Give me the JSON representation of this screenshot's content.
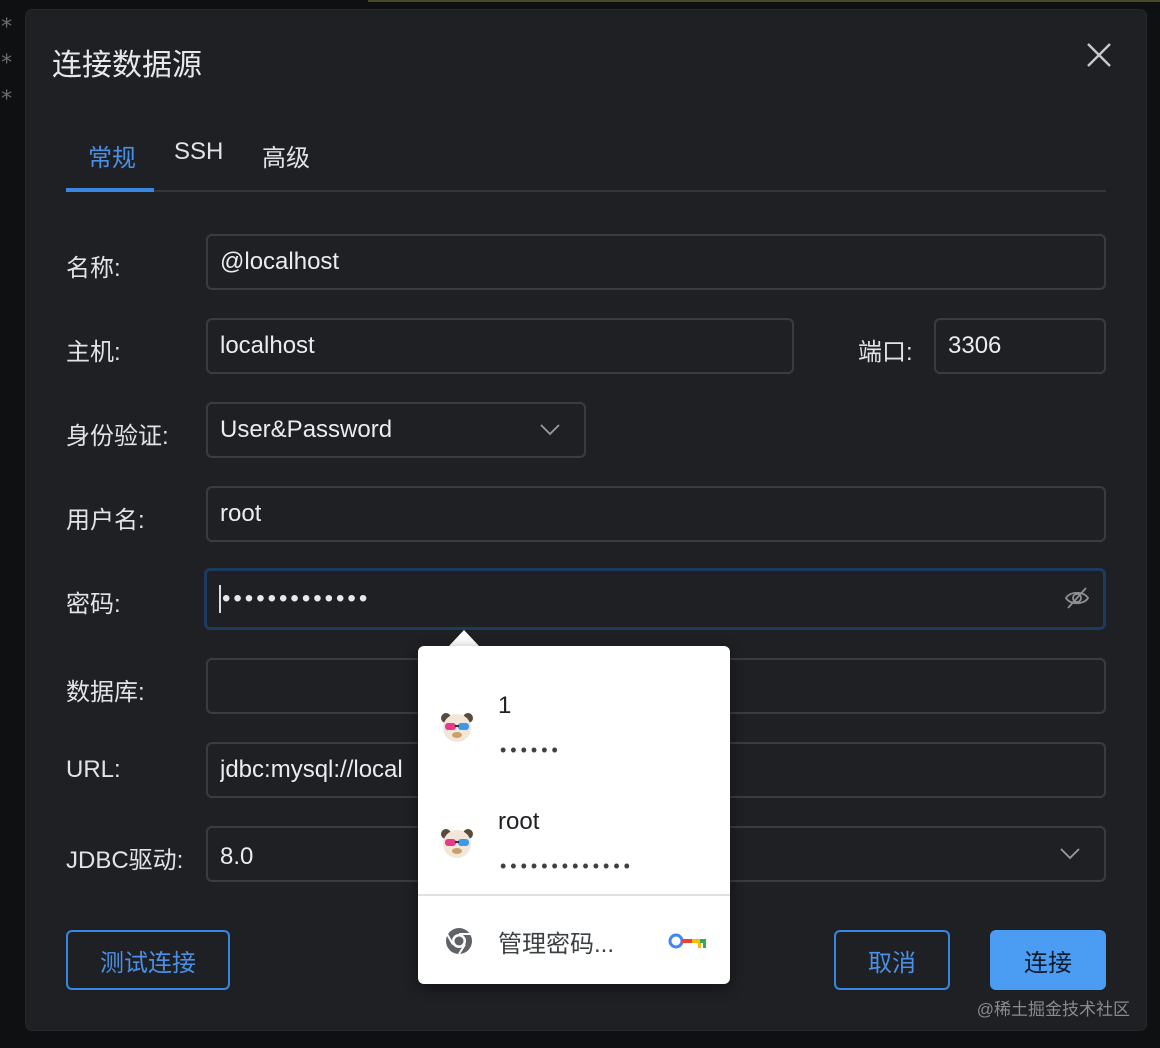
{
  "background": {
    "asterisks": [
      "*",
      "*",
      "*"
    ]
  },
  "dialog": {
    "title": "连接数据源",
    "tabs": [
      {
        "label": "常规",
        "active": true
      },
      {
        "label": "SSH",
        "active": false
      },
      {
        "label": "高级",
        "active": false
      }
    ]
  },
  "form": {
    "name": {
      "label": "名称:",
      "value": "@localhost"
    },
    "host": {
      "label": "主机:",
      "value": "localhost"
    },
    "port": {
      "label": "端口:",
      "value": "3306"
    },
    "auth": {
      "label": "身份验证:",
      "value": "User&Password"
    },
    "username": {
      "label": "用户名:",
      "value": "root"
    },
    "password": {
      "label": "密码:",
      "value": "•••••••••••••"
    },
    "database": {
      "label": "数据库:",
      "value": ""
    },
    "url": {
      "label": "URL:",
      "value": "jdbc:mysql://local"
    },
    "driver": {
      "label": "JDBC驱动:",
      "value": "8.0"
    }
  },
  "buttons": {
    "test": "测试连接",
    "cancel": "取消",
    "connect": "连接"
  },
  "password_popup": {
    "credentials": [
      {
        "username": "1",
        "password_mask": "••••••"
      },
      {
        "username": "root",
        "password_mask": "•••••••••••••"
      }
    ],
    "manage_label": "管理密码..."
  },
  "watermark": "@稀土掘金技术社区",
  "colors": {
    "accent": "#3a86e0",
    "dialog_bg": "#1f2024",
    "field_border": "#3a3c41",
    "primary_button": "#4a9df2"
  }
}
